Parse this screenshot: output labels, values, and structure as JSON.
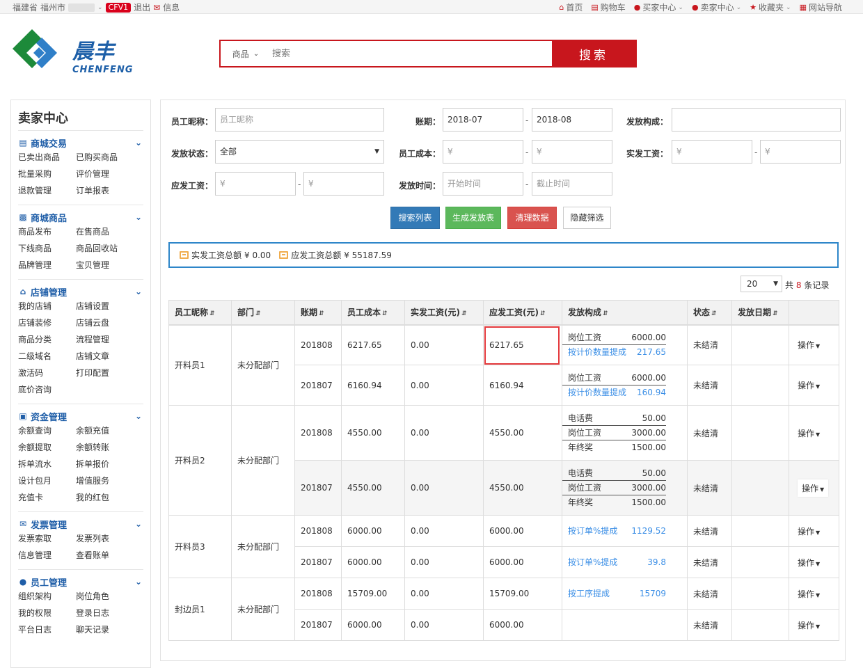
{
  "topbar": {
    "province": "福建省",
    "city": "福州市",
    "badge": "CFV1",
    "logout": "退出",
    "messages": "信息",
    "links": [
      "首页",
      "购物车",
      "买家中心",
      "卖家中心",
      "收藏夹",
      "网站导航"
    ]
  },
  "logo": {
    "cn": "晨丰",
    "en": "CHENFENG"
  },
  "search": {
    "category": "商品",
    "placeholder": "搜索",
    "button": "搜索"
  },
  "sidebar": {
    "title": "卖家中心",
    "sections": [
      {
        "title": "商城交易",
        "icon": "card-icon",
        "items": [
          "已卖出商品",
          "已购买商品",
          "批量采购",
          "评价管理",
          "退款管理",
          "订单报表"
        ]
      },
      {
        "title": "商城商品",
        "icon": "truck-icon",
        "items": [
          "商品发布",
          "在售商品",
          "下线商品",
          "商品回收站",
          "品牌管理",
          "宝贝管理"
        ]
      },
      {
        "title": "店铺管理",
        "icon": "home-icon",
        "items": [
          "我的店铺",
          "店铺设置",
          "店铺装修",
          "店铺云盘",
          "商品分类",
          "流程管理",
          "二级域名",
          "店铺文章",
          "激活码",
          "打印配置",
          "底价咨询"
        ]
      },
      {
        "title": "资金管理",
        "icon": "money-icon",
        "items": [
          "余额查询",
          "余额充值",
          "余额提取",
          "余额转账",
          "拆单流水",
          "拆单报价",
          "设计包月",
          "增值服务",
          "充值卡",
          "我的红包"
        ]
      },
      {
        "title": "发票管理",
        "icon": "envelope-icon",
        "items": [
          "发票索取",
          "发票列表",
          "信息管理",
          "查看账单"
        ]
      },
      {
        "title": "员工管理",
        "icon": "users-icon",
        "items": [
          "组织架构",
          "岗位角色",
          "我的权限",
          "登录日志",
          "平台日志",
          "聊天记录"
        ]
      }
    ]
  },
  "filters": {
    "nickname_label": "员工昵称：",
    "nickname_placeholder": "员工昵称",
    "period_label": "账期：",
    "period_from": "2018-07",
    "period_to": "2018-08",
    "composition_label": "发放构成：",
    "status_label": "发放状态：",
    "status_value": "全部",
    "cost_label": "员工成本：",
    "actual_label": "实发工资：",
    "payable_label": "应发工资：",
    "time_label": "发放时间：",
    "time_from_placeholder": "开始时间",
    "time_to_placeholder": "截止时间",
    "yen": "¥",
    "dash": "-"
  },
  "buttons": {
    "search": "搜索列表",
    "generate": "生成发放表",
    "clear": "清理数据",
    "hide": "隐藏筛选"
  },
  "summary": {
    "actual_label": "实发工资总额",
    "actual_value": "¥ 0.00",
    "payable_label": "应发工资总额",
    "payable_value": "¥ 55187.59"
  },
  "pager": {
    "page_size": "20",
    "total_prefix": "共",
    "total_count": "8",
    "total_suffix": "条记录"
  },
  "table": {
    "headers": [
      "员工昵称",
      "部门",
      "账期",
      "员工成本",
      "实发工资(元)",
      "应发工资(元)",
      "发放构成",
      "状态",
      "发放日期",
      ""
    ],
    "ops_label": "操作",
    "groups": [
      {
        "name": "开料员1",
        "dept": "未分配部门",
        "rows": [
          {
            "period": "201808",
            "cost": "6217.65",
            "actual": "0.00",
            "payable": "6217.65",
            "status": "未结清",
            "comp": [
              {
                "label": "岗位工资",
                "value": "6000.00",
                "link": false,
                "lined": true
              },
              {
                "label": "按计价数量提成",
                "value": "217.65",
                "link": true,
                "lined": false
              }
            ]
          },
          {
            "period": "201807",
            "cost": "6160.94",
            "actual": "0.00",
            "payable": "6160.94",
            "status": "未结清",
            "comp": [
              {
                "label": "岗位工资",
                "value": "6000.00",
                "link": false,
                "lined": true
              },
              {
                "label": "按计价数量提成",
                "value": "160.94",
                "link": true,
                "lined": false
              }
            ]
          }
        ]
      },
      {
        "name": "开料员2",
        "dept": "未分配部门",
        "rows": [
          {
            "period": "201808",
            "cost": "4550.00",
            "actual": "0.00",
            "payable": "4550.00",
            "status": "未结清",
            "comp": [
              {
                "label": "电话费",
                "value": "50.00",
                "link": false,
                "lined": true
              },
              {
                "label": "岗位工资",
                "value": "3000.00",
                "link": false,
                "lined": true
              },
              {
                "label": "年终奖",
                "value": "1500.00",
                "link": false,
                "lined": false
              }
            ]
          },
          {
            "period": "201807",
            "cost": "4550.00",
            "actual": "0.00",
            "payable": "4550.00",
            "status": "未结清",
            "comp": [
              {
                "label": "电话费",
                "value": "50.00",
                "link": false,
                "lined": true
              },
              {
                "label": "岗位工资",
                "value": "3000.00",
                "link": false,
                "lined": true
              },
              {
                "label": "年终奖",
                "value": "1500.00",
                "link": false,
                "lined": false
              }
            ]
          }
        ]
      },
      {
        "name": "开料员3",
        "dept": "未分配部门",
        "rows": [
          {
            "period": "201808",
            "cost": "6000.00",
            "actual": "0.00",
            "payable": "6000.00",
            "status": "未结清",
            "comp": [
              {
                "label": "按订单%提成",
                "value": "1129.52",
                "link": true,
                "lined": false
              }
            ]
          },
          {
            "period": "201807",
            "cost": "6000.00",
            "actual": "0.00",
            "payable": "6000.00",
            "status": "未结清",
            "comp": [
              {
                "label": "按订单%提成",
                "value": "39.8",
                "link": true,
                "lined": false
              }
            ]
          }
        ]
      },
      {
        "name": "封边员1",
        "dept": "未分配部门",
        "rows": [
          {
            "period": "201808",
            "cost": "15709.00",
            "actual": "0.00",
            "payable": "15709.00",
            "status": "未结清",
            "comp": [
              {
                "label": "按工序提成",
                "value": "15709",
                "link": true,
                "lined": false
              }
            ]
          },
          {
            "period": "201807",
            "cost": "6000.00",
            "actual": "0.00",
            "payable": "6000.00",
            "status": "未结清",
            "comp": []
          }
        ]
      }
    ]
  }
}
